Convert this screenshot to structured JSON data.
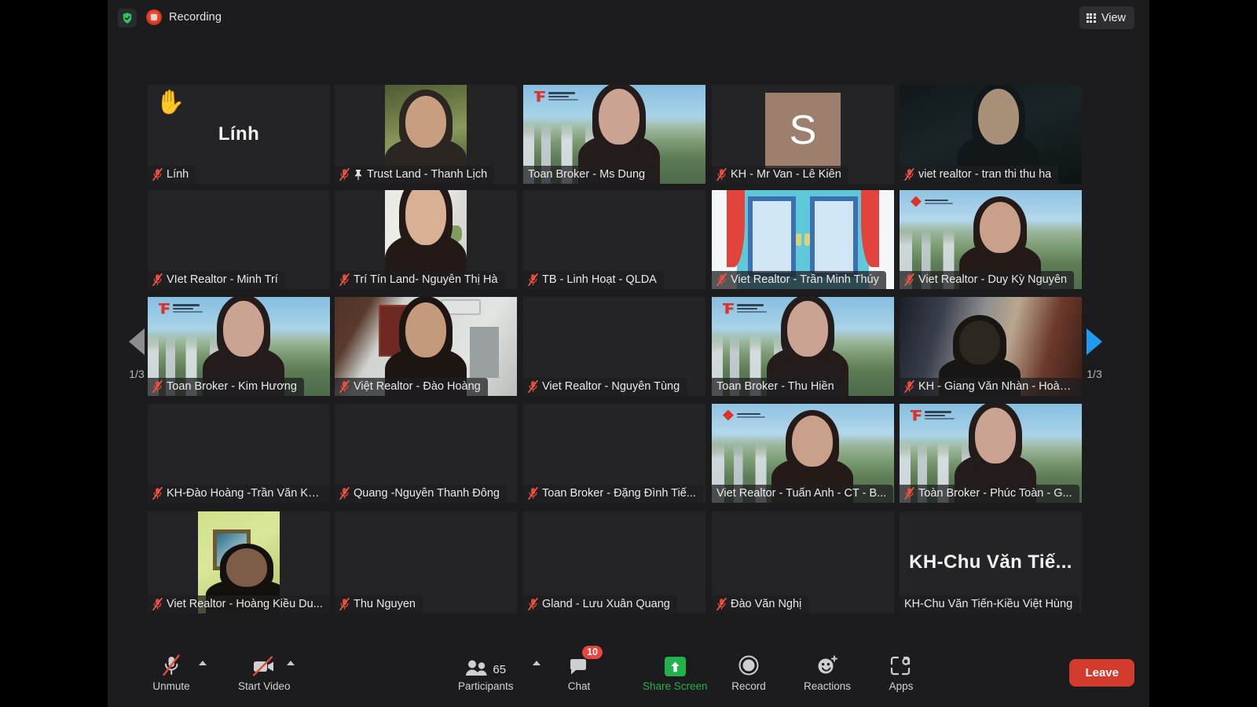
{
  "app": {
    "title": "Zoom Meeting",
    "recording_label": "Recording",
    "view_label": "View",
    "security_icon": "shield-check-icon",
    "recording_icon": "record-indicator-icon",
    "view_icon": "grid-view-icon",
    "accent_active_border": "#d8f135",
    "accent_leave": "#d33b2c",
    "accent_share": "#23b14b",
    "accent_badge": "#e8453c",
    "accent_pager_next": "#1f9bf0"
  },
  "pager": {
    "prev_icon": "chevron-left-triangle-icon",
    "next_icon": "chevron-right-triangle-icon",
    "prev_label": "1/3",
    "next_label": "1/3"
  },
  "gallery": {
    "columns": 5,
    "rows": 5,
    "participants": [
      {
        "name": "Lính",
        "muted": true,
        "pinned": false,
        "video": false,
        "active": false,
        "raise_hand": true,
        "display": "name-center",
        "center_text": "Lính"
      },
      {
        "name": "Trust Land - Thanh Lịch",
        "muted": true,
        "pinned": true,
        "video": true,
        "active": false,
        "raise_hand": false,
        "display": "photo-portrait",
        "bg": "outdoor-green"
      },
      {
        "name": "Toan Broker - Ms Dung",
        "muted": false,
        "pinned": false,
        "video": true,
        "active": false,
        "raise_hand": false,
        "display": "video-wide",
        "bg": "toan-broker-virtual"
      },
      {
        "name": "KH - Mr Van - Lê Kiên",
        "muted": true,
        "pinned": false,
        "video": false,
        "active": false,
        "raise_hand": false,
        "display": "avatar",
        "initial": "S"
      },
      {
        "name": "viet realtor - tran thi thu ha",
        "muted": true,
        "pinned": false,
        "video": true,
        "active": false,
        "raise_hand": false,
        "display": "video-wide",
        "bg": "dark-room"
      },
      {
        "name": "VIet Realtor - Minh Trí",
        "muted": true,
        "pinned": false,
        "video": false,
        "active": false,
        "raise_hand": false,
        "display": "blank"
      },
      {
        "name": "Trí Tín Land- Nguyễn Thị Hà",
        "muted": true,
        "pinned": false,
        "video": true,
        "active": false,
        "raise_hand": false,
        "display": "photo-portrait",
        "bg": "indoor-white"
      },
      {
        "name": "TB - Linh Hoạt - QLDA",
        "muted": true,
        "pinned": false,
        "video": false,
        "active": false,
        "raise_hand": false,
        "display": "blank"
      },
      {
        "name": "Viet Realtor - Trần Minh Thúy",
        "muted": true,
        "pinned": false,
        "video": true,
        "active": false,
        "raise_hand": false,
        "display": "video-wide",
        "bg": "cartoon-window"
      },
      {
        "name": "Viet Realtor - Duy Kỳ Nguyên",
        "muted": true,
        "pinned": false,
        "video": true,
        "active": false,
        "raise_hand": false,
        "display": "video-wide",
        "bg": "viet-realtor-virtual"
      },
      {
        "name": "Toan Broker - Kim Hương",
        "muted": true,
        "pinned": false,
        "video": true,
        "active": false,
        "raise_hand": false,
        "display": "video-wide",
        "bg": "toan-broker-virtual"
      },
      {
        "name": "Việt Realtor - Đào Hoàng",
        "muted": true,
        "pinned": false,
        "video": true,
        "active": false,
        "raise_hand": false,
        "display": "video-wide",
        "bg": "office-wall"
      },
      {
        "name": "Viet Realtor - Nguyễn Tùng",
        "muted": true,
        "pinned": false,
        "video": false,
        "active": false,
        "raise_hand": false,
        "display": "blank"
      },
      {
        "name": "Toan Broker - Thu Hiền",
        "muted": false,
        "pinned": false,
        "video": true,
        "active": true,
        "raise_hand": false,
        "display": "video-wide",
        "bg": "toan-broker-virtual"
      },
      {
        "name": "KH - Giang Văn Nhàn - Hoàn...",
        "muted": true,
        "pinned": false,
        "video": true,
        "active": false,
        "raise_hand": false,
        "display": "video-wide",
        "bg": "curtain-room"
      },
      {
        "name": "KH-Đào Hoàng -Trần Văn Kh...",
        "muted": true,
        "pinned": false,
        "video": false,
        "active": false,
        "raise_hand": false,
        "display": "blank"
      },
      {
        "name": "Quang -Nguyễn Thanh Đông",
        "muted": true,
        "pinned": false,
        "video": false,
        "active": false,
        "raise_hand": false,
        "display": "blank"
      },
      {
        "name": "Toan Broker - Đặng Đình Tiế...",
        "muted": true,
        "pinned": false,
        "video": false,
        "active": false,
        "raise_hand": false,
        "display": "blank"
      },
      {
        "name": "Viet Realtor - Tuấn Anh - CT - B...",
        "muted": false,
        "pinned": false,
        "video": true,
        "active": false,
        "raise_hand": false,
        "display": "video-wide",
        "bg": "viet-realtor-virtual"
      },
      {
        "name": "Toàn Broker - Phúc Toàn - G...",
        "muted": true,
        "pinned": false,
        "video": true,
        "active": false,
        "raise_hand": false,
        "display": "video-wide",
        "bg": "toan-broker-virtual"
      },
      {
        "name": "Viet Realtor - Hoàng Kiều Du...",
        "muted": true,
        "pinned": false,
        "video": true,
        "active": false,
        "raise_hand": false,
        "display": "photo-portrait",
        "bg": "green-wall"
      },
      {
        "name": "Thu Nguyen",
        "muted": true,
        "pinned": false,
        "video": false,
        "active": false,
        "raise_hand": false,
        "display": "blank"
      },
      {
        "name": "Gland - Lưu Xuân Quang",
        "muted": true,
        "pinned": false,
        "video": false,
        "active": false,
        "raise_hand": false,
        "display": "blank"
      },
      {
        "name": "Đào Văn Nghị",
        "muted": true,
        "pinned": false,
        "video": false,
        "active": false,
        "raise_hand": false,
        "display": "blank"
      },
      {
        "name": "KH-Chu Văn Tiến-Kiều Việt Hùng",
        "muted": false,
        "pinned": false,
        "video": false,
        "active": false,
        "raise_hand": false,
        "display": "name-center",
        "center_text": "KH-Chu Văn Tiế..."
      }
    ]
  },
  "toolbar": {
    "items": [
      {
        "label": "Unmute",
        "icon": "microphone-muted-icon",
        "has_caret": true,
        "badge": null,
        "count": null,
        "green": false
      },
      {
        "label": "Start Video",
        "icon": "video-camera-off-icon",
        "has_caret": true,
        "badge": null,
        "count": null,
        "green": false
      },
      {
        "label": "Participants",
        "icon": "participants-icon",
        "has_caret": true,
        "badge": null,
        "count": "65",
        "green": false
      },
      {
        "label": "Chat",
        "icon": "chat-bubble-icon",
        "has_caret": false,
        "badge": "10",
        "count": null,
        "green": false
      },
      {
        "label": "Share Screen",
        "icon": "share-screen-icon",
        "has_caret": false,
        "badge": null,
        "count": null,
        "green": true
      },
      {
        "label": "Record",
        "icon": "record-circle-icon",
        "has_caret": false,
        "badge": null,
        "count": null,
        "green": false
      },
      {
        "label": "Reactions",
        "icon": "reactions-smiley-icon",
        "has_caret": false,
        "badge": null,
        "count": null,
        "green": false
      },
      {
        "label": "Apps",
        "icon": "apps-icon",
        "has_caret": false,
        "badge": null,
        "count": null,
        "green": false
      }
    ],
    "leave_label": "Leave"
  }
}
